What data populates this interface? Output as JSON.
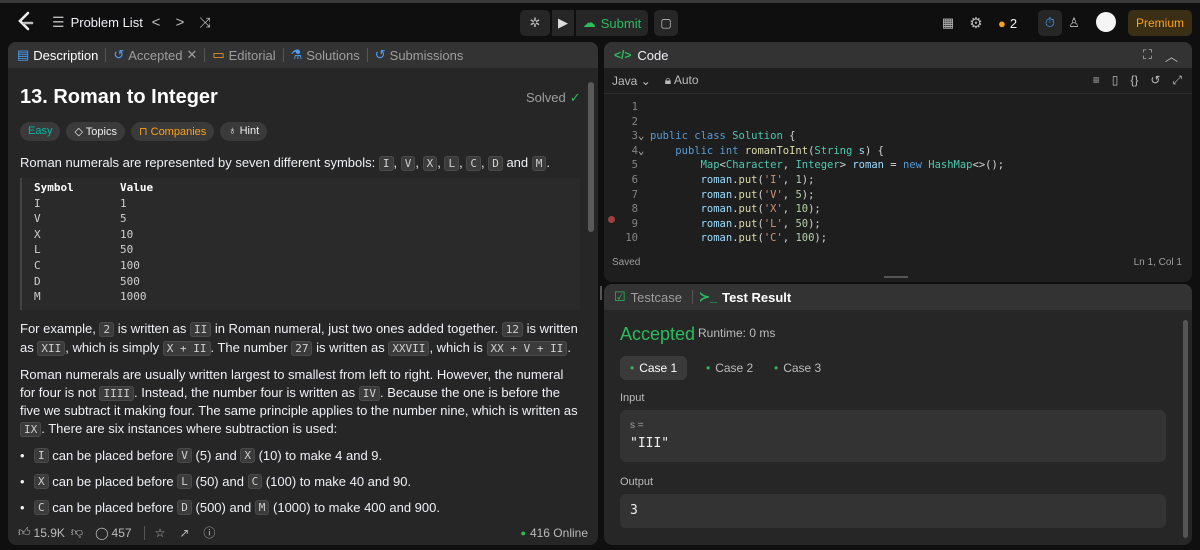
{
  "topbar": {
    "problem_list": "Problem List",
    "submit": "Submit",
    "streak": "2",
    "premium": "Premium"
  },
  "tabs": {
    "description": "Description",
    "accepted": "Accepted",
    "editorial": "Editorial",
    "solutions": "Solutions",
    "submissions": "Submissions"
  },
  "problem": {
    "title": "13. Roman to Integer",
    "status": "Solved",
    "tags": {
      "difficulty": "Easy",
      "topics": "Topics",
      "companies": "Companies",
      "hint": "Hint"
    },
    "intro": "Roman numerals are represented by seven different symbols: ",
    "symbols": [
      "I",
      "V",
      "X",
      "L",
      "C",
      "D",
      "M"
    ],
    "intro_and": "and",
    "table": {
      "header_symbol": "Symbol",
      "header_value": "Value",
      "rows": [
        [
          "I",
          "1"
        ],
        [
          "V",
          "5"
        ],
        [
          "X",
          "10"
        ],
        [
          "L",
          "50"
        ],
        [
          "C",
          "100"
        ],
        [
          "D",
          "500"
        ],
        [
          "M",
          "1000"
        ]
      ]
    },
    "p2": {
      "a": "For example, ",
      "c1": "2",
      "b": " is written as ",
      "c2": "II",
      "c": " in Roman numeral, just two ones added together. ",
      "c3": "12",
      "d": " is written as ",
      "c4": "XII",
      "e": ", which is simply ",
      "c5": "X + II",
      "f": ". The number ",
      "c6": "27",
      "g": " is written as ",
      "c7": "XXVII",
      "h": ", which is ",
      "c8": "XX + V + II",
      "i": "."
    },
    "p3": {
      "a": "Roman numerals are usually written largest to smallest from left to right. However, the numeral for four is not ",
      "c1": "IIII",
      "b": ". Instead, the number four is written as ",
      "c2": "IV",
      "c": ". Because the one is before the five we subtract it making four. The same principle applies to the number nine, which is written as ",
      "c3": "IX",
      "d": ". There are six instances where subtraction is used:"
    },
    "bullets": [
      {
        "c1": "I",
        "t1": " can be placed before ",
        "c2": "V",
        "t2": " (5) and ",
        "c3": "X",
        "t3": " (10) to make 4 and 9."
      },
      {
        "c1": "X",
        "t1": " can be placed before ",
        "c2": "L",
        "t2": " (50) and ",
        "c3": "C",
        "t3": " (100) to make 40 and 90."
      },
      {
        "c1": "C",
        "t1": " can be placed before ",
        "c2": "D",
        "t2": " (500) and ",
        "c3": "M",
        "t3": " (1000) to make 400 and 900."
      }
    ]
  },
  "footer": {
    "likes": "15.9K",
    "comments": "457",
    "online": "416 Online"
  },
  "code_panel": {
    "title": "Code",
    "language": "Java",
    "auto": "Auto",
    "saved": "Saved",
    "cursor": "Ln 1, Col 1",
    "line_numbers": [
      "1",
      "2",
      "3",
      "4",
      "5",
      "6",
      "7",
      "8",
      "9",
      "10"
    ]
  },
  "result_panel": {
    "testcase_tab": "Testcase",
    "result_tab": "Test Result",
    "status": "Accepted",
    "runtime": "Runtime: 0 ms",
    "cases": [
      "Case 1",
      "Case 2",
      "Case 3"
    ],
    "input_label": "Input",
    "input_var": "s =",
    "input_value": "\"III\"",
    "output_label": "Output",
    "output_value": "3"
  },
  "colors": {
    "accent_green": "#2cbb5d",
    "accent_orange": "#ffa116",
    "easy": "#00b8a3",
    "premium": "#ffa116"
  }
}
